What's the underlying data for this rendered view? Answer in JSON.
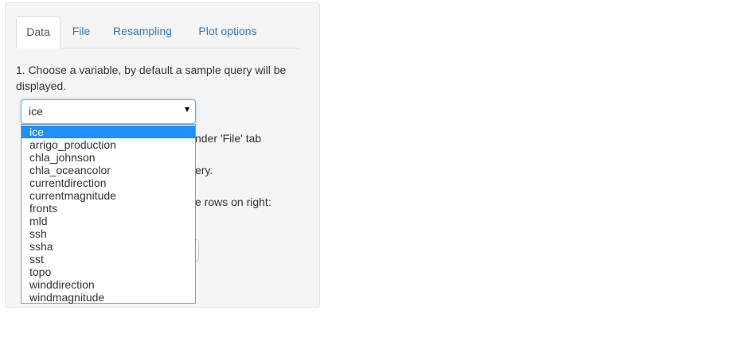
{
  "tabs": [
    {
      "label": "Data",
      "active": true
    },
    {
      "label": "File",
      "active": false
    },
    {
      "label": "Resampling",
      "active": false
    },
    {
      "label": "Plot options",
      "active": false
    }
  ],
  "instruction": "1. Choose a variable, by default a sample query will be displayed.",
  "variable_select": {
    "value": "ice",
    "options": [
      "ice",
      "arrigo_production",
      "chla_johnson",
      "chla_oceancolor",
      "currentdirection",
      "currentmagnitude",
      "fronts",
      "mld",
      "ssh",
      "ssha",
      "sst",
      "topo",
      "winddirection",
      "windmagnitude"
    ]
  },
  "partially_hidden_text": {
    "line1": "nder 'File' tab",
    "line2": "ery.",
    "line3": "e rows on right:"
  },
  "colors": {
    "link": "#337ab7",
    "selection": "#1e90ff",
    "well_background": "#f5f5f5",
    "focus_border": "#66afe9"
  }
}
